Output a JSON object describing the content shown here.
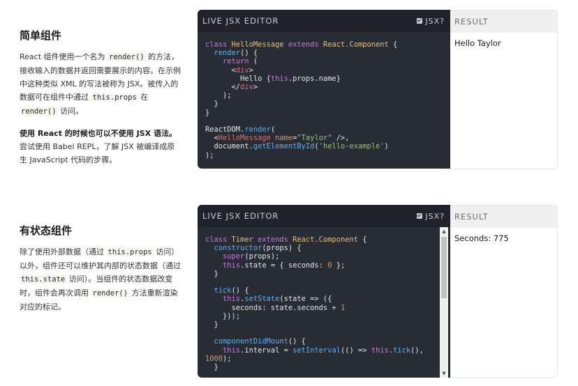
{
  "section1": {
    "heading": "简单组件",
    "para1_a": "React 组件使用一个名为 ",
    "para1_code1": "render()",
    "para1_b": " 的方法，接收输入的数据并返回需要展示的内容。在示例中这种类似 XML 的写法被称为 JSX。被传入的数据可在组件中通过 ",
    "para1_code2": "this.props",
    "para1_c": " 在 ",
    "para1_code3": "render()",
    "para1_d": " 访问。",
    "bold": "使用 React 的时候也可以不使用 JSX 语法。",
    "para2": "尝试使用 Babel REPL，了解 JSX 被编译成原生 JavaScript 代码的步骤。",
    "editor_title": "LIVE JSX EDITOR",
    "jsx_label": "JSX?",
    "result_title": "RESULT",
    "result_text": "Hello Taylor",
    "code": {
      "l1": [
        "class",
        " ",
        "HelloMessage",
        " extends ",
        "React.Component",
        " {"
      ],
      "l2": [
        "  ",
        "render",
        "() {"
      ],
      "l3": [
        "    ",
        "return",
        " ("
      ],
      "l4": [
        "      <",
        "div",
        ">"
      ],
      "l5": [
        "        Hello {",
        "this",
        ".props.name}"
      ],
      "l6": [
        "      </",
        "div",
        ">"
      ],
      "l7": "    );",
      "l8": "  }",
      "l9": "}",
      "l10": [
        "ReactDOM",
        ".",
        "render",
        "("
      ],
      "l11": [
        "  <",
        "HelloMessage",
        " ",
        "name",
        "=",
        "\"Taylor\"",
        " />,"
      ],
      "l12": [
        "  document.",
        "getElementById",
        "(",
        "'hello-example'",
        ")"
      ],
      "l13": ");"
    }
  },
  "section2": {
    "heading": "有状态组件",
    "para_a": "除了使用外部数据（通过 ",
    "para_code1": "this.props",
    "para_b": " 访问）以外，组件还可以维护其内部的状态数据（通过 ",
    "para_code2": "this.state",
    "para_c": " 访问）。当组件的状态数据改变时，组件会再次调用 ",
    "para_code3": "render()",
    "para_d": " 方法重新渲染对应的标记。",
    "editor_title": "LIVE JSX EDITOR",
    "jsx_label": "JSX?",
    "result_title": "RESULT",
    "result_text": "Seconds: 775",
    "code": {
      "l1": [
        "class",
        " ",
        "Timer",
        " extends ",
        "React.Component",
        " {"
      ],
      "l2": [
        "  ",
        "constructor",
        "(props) {"
      ],
      "l3": [
        "    ",
        "super",
        "(props);"
      ],
      "l4": [
        "    ",
        "this",
        ".state = { seconds: ",
        "0",
        " };"
      ],
      "l5": "  }",
      "l7": [
        "  ",
        "tick",
        "() {"
      ],
      "l8": [
        "    ",
        "this",
        ".",
        "setState",
        "(state => ({"
      ],
      "l9": [
        "      seconds: state.seconds + ",
        "1"
      ],
      "l10": "    }));",
      "l11": "  }",
      "l13": [
        "  ",
        "componentDidMount",
        "() {"
      ],
      "l14": [
        "    ",
        "this",
        ".interval = ",
        "setInterval",
        "(() => ",
        "this",
        ".",
        "tick",
        "(),"
      ],
      "l15": [
        "1000",
        ");"
      ],
      "l16": "  }"
    }
  }
}
